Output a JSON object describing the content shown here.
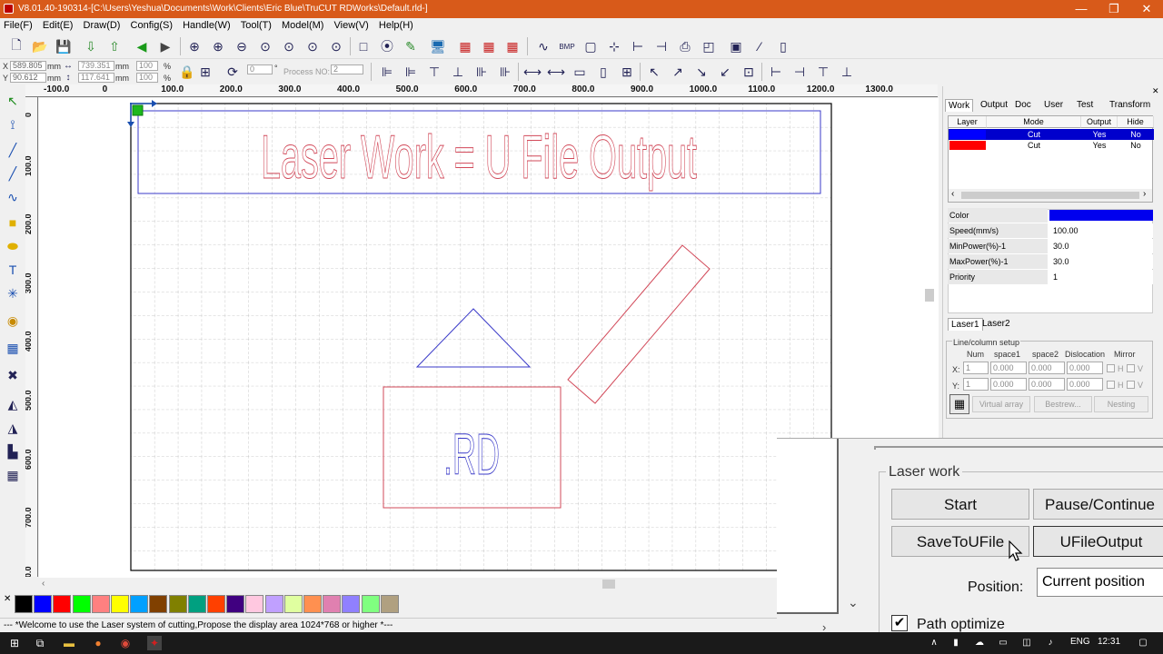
{
  "window": {
    "title": "V8.01.40-190314-[C:\\Users\\Yeshua\\Documents\\Work\\Clients\\Eric Blue\\TruCUT RDWorks\\Default.rld-]",
    "minimize": "—",
    "maximize": "❐",
    "close": "✕"
  },
  "menu": [
    "File(F)",
    "Edit(E)",
    "Draw(D)",
    "Config(S)",
    "Handle(W)",
    "Tool(T)",
    "Model(M)",
    "View(V)",
    "Help(H)"
  ],
  "coords": {
    "x_label": "X",
    "x_value": "589.805",
    "x_unit": "mm",
    "y_label": "Y",
    "y_value": "90.612",
    "y_unit": "mm",
    "w_value": "739.351",
    "w_unit": "mm",
    "h_value": "117.641",
    "h_unit": "mm",
    "w_pct": "100",
    "h_pct": "100",
    "pct_unit": "%",
    "rotate_value": "0",
    "rotate_unit": "°",
    "process_label": "Process NO:",
    "process_value": "2"
  },
  "rulers": {
    "h_ticks": [
      "-100.0",
      "0",
      "100.0",
      "200.0",
      "300.0",
      "400.0",
      "500.0",
      "600.0",
      "700.0",
      "800.0",
      "900.0",
      "1000.0",
      "1100.0",
      "1200.0",
      "1300.0"
    ],
    "v_ticks": [
      "0",
      "100.0",
      "200.0",
      "300.0",
      "400.0",
      "500.0",
      "600.0",
      "700.0",
      "800.0"
    ]
  },
  "canvas": {
    "title_text": "Laser Work = U File Output",
    "box_text": ".RD",
    "colors": {
      "blue": "#3a3ac8",
      "red": "#d24a5a"
    }
  },
  "palette": [
    "#000000",
    "#0000ff",
    "#ff0000",
    "#00ff00",
    "#ff8080",
    "#ffff00",
    "#00a0ff",
    "#804000",
    "#808000",
    "#00a080",
    "#ff4000",
    "#400080",
    "#ffc8e0",
    "#c0a0ff",
    "#e0ffa0",
    "#ff9050",
    "#e080b0",
    "#9080ff",
    "#80ff80",
    "#b0a080"
  ],
  "status": "--- *Welcome to use the Laser system of cutting,Propose the display area 1024*768 or higher *---",
  "panel": {
    "tabs": [
      "Work",
      "Output",
      "Doc",
      "User",
      "Test",
      "Transform"
    ],
    "layer_headers": [
      "Layer",
      "Mode",
      "Output",
      "Hide"
    ],
    "layers": [
      {
        "color": "#0000ff",
        "mode": "Cut",
        "output": "Yes",
        "hide": "No"
      },
      {
        "color": "#ff0000",
        "mode": "Cut",
        "output": "Yes",
        "hide": "No"
      }
    ],
    "props": [
      {
        "key": "Color",
        "value": ""
      },
      {
        "key": "Speed(mm/s)",
        "value": "100.00"
      },
      {
        "key": "MinPower(%)-1",
        "value": "30.0"
      },
      {
        "key": "MaxPower(%)-1",
        "value": "30.0"
      },
      {
        "key": "Priority",
        "value": "1"
      }
    ],
    "laser_tabs": [
      "Laser1",
      "Laser2"
    ],
    "array": {
      "group_label": "Line/column setup",
      "headers": [
        "Num",
        "space1",
        "space2",
        "Dislocation",
        "Mirror"
      ],
      "x_label": "X:",
      "y_label": "Y:",
      "x_row": [
        "1",
        "0.000",
        "0.000",
        "0.000"
      ],
      "y_row": [
        "1",
        "0.000",
        "0.000",
        "0.000"
      ],
      "mirror_h": "H",
      "mirror_v": "V",
      "virtual_array": "Virtual array",
      "bestrew": "Bestrew...",
      "nesting": "Nesting"
    }
  },
  "laser_work": {
    "group_label": "Laser work",
    "start": "Start",
    "pause": "Pause/Continue",
    "save_to_ufile": "SaveToUFile",
    "ufile_output": "UFileOutput",
    "position_label": "Position:",
    "position_value": "Current position",
    "path_optimize": "Path optimize"
  },
  "taskbar": {
    "lang": "ENG",
    "time": "12:31"
  }
}
